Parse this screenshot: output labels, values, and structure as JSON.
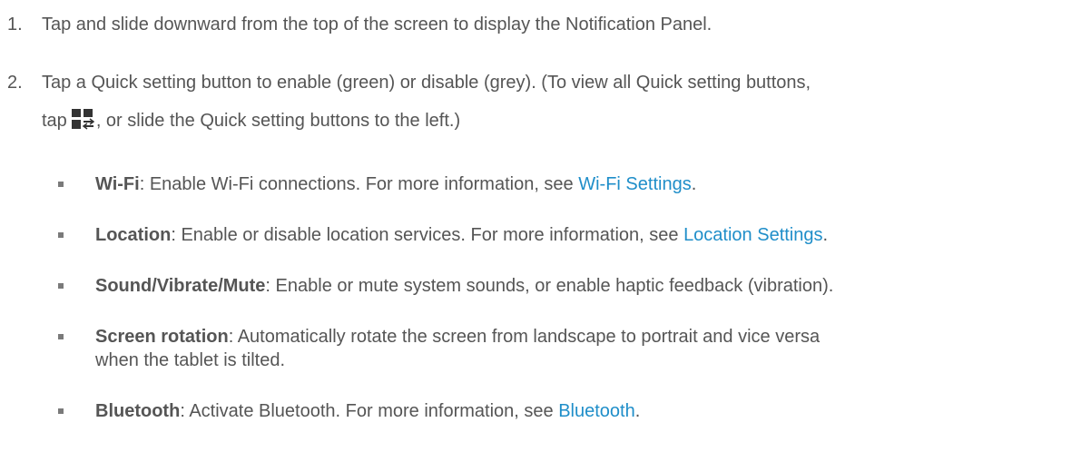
{
  "steps": [
    {
      "number": "1.",
      "text": "Tap and slide downward from the top of the screen to display the Notification Panel."
    },
    {
      "number": "2.",
      "line1": "Tap a Quick setting button to enable (green) or disable (grey). (To view all Quick setting buttons,",
      "line2_before": "tap",
      "icon": "quick-settings-edit-icon",
      "line2_after": ", or slide the Quick setting buttons to the left.)"
    }
  ],
  "bullets": [
    {
      "term": "Wi-Fi",
      "text": ": Enable Wi-Fi connections. For more information, see ",
      "link": "Wi-Fi Settings",
      "after": "."
    },
    {
      "term": "Location",
      "text": ": Enable or disable location services. For more information, see ",
      "link": "Location Settings",
      "after": "."
    },
    {
      "term": "Sound/Vibrate/Mute",
      "text": ": Enable or mute system sounds, or enable haptic feedback (vibration)."
    },
    {
      "term": "Screen rotation",
      "text": ": Automatically rotate the screen from landscape to portrait and vice versa",
      "continuation": "when the tablet is tilted."
    },
    {
      "term": "Bluetooth",
      "text": ": Activate Bluetooth. For more information, see ",
      "link": "Bluetooth",
      "after": "."
    }
  ],
  "colors": {
    "text": "#555555",
    "link": "#1f8ec9",
    "bullet": "#7a7a7a",
    "icon": "#333333"
  }
}
